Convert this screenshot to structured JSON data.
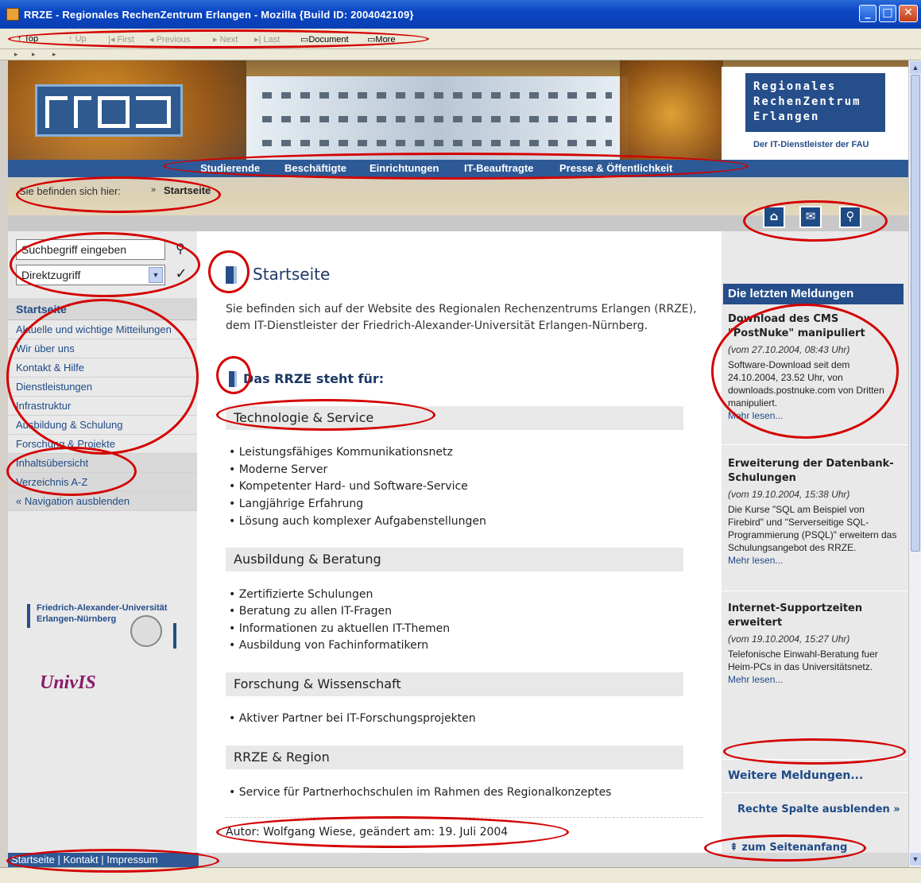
{
  "window": {
    "title": "RRZE - Regionales RechenZentrum Erlangen - Mozilla {Build ID: 2004042109}",
    "minimize": "_",
    "maximize": "□",
    "close": "✕"
  },
  "linkbar": {
    "top": "Top",
    "up": "Up",
    "first": "First",
    "previous": "Previous",
    "next": "Next",
    "last": "Last",
    "document": "Document",
    "more": "More"
  },
  "header": {
    "brand_lines": [
      "Regionales",
      "RechenZentrum",
      "Erlangen"
    ],
    "tagline": "Der IT-Dienstleister der FAU",
    "nav": [
      "Studierende",
      "Beschäftigte",
      "Einrichtungen",
      "IT-Beauftragte",
      "Presse & Öffentlichkeit"
    ],
    "breadcrumb_label": "Sie befinden sich hier:",
    "breadcrumb_current": "Startseite",
    "icons": [
      "home-icon",
      "mail-icon",
      "search-icon"
    ]
  },
  "left": {
    "search_value": "Suchbegriff eingeben",
    "direct_value": "Direktzugriff",
    "nav_head": "Startseite",
    "nav_items": [
      "Aktuelle und wichtige Mitteilungen",
      "Wir über uns",
      "Kontakt & Hilfe",
      "Dienstleistungen",
      "Infrastruktur",
      "Ausbildung & Schulung",
      "Forschung & Projekte",
      "Inhaltsübersicht",
      "Verzeichnis A-Z",
      "Navigation ausblenden"
    ],
    "fau_lines": [
      "Friedrich-Alexander-Universität",
      "Erlangen-Nürnberg"
    ],
    "univis": "UnivIS"
  },
  "footer": {
    "links": [
      "Startseite",
      "Kontakt",
      "Impressum"
    ],
    "separator": "|"
  },
  "main": {
    "title": "Startseite",
    "intro": "Sie befinden sich auf der Website des Regionalen Rechenzentrums Erlangen (RRZE), dem IT-Dienstleister der Friedrich-Alexander-Universität Erlangen-Nürnberg.",
    "subtitle": "Das RRZE steht für:",
    "sections": [
      {
        "heading": "Technologie & Service",
        "items": [
          "Leistungsfähiges Kommunikationsnetz",
          "Moderne Server",
          "Kompetenter Hard- und Software-Service",
          "Langjährige Erfahrung",
          "Lösung auch komplexer Aufgabenstellungen"
        ]
      },
      {
        "heading": "Ausbildung & Beratung",
        "items": [
          "Zertifizierte Schulungen",
          "Beratung zu allen IT-Fragen",
          "Informationen zu aktuellen IT-Themen",
          "Ausbildung von Fachinformatikern"
        ]
      },
      {
        "heading": "Forschung & Wissenschaft",
        "items": [
          "Aktiver Partner bei IT-Forschungsprojekten"
        ]
      },
      {
        "heading": "RRZE & Region",
        "items": [
          "Service für Partnerhochschulen im Rahmen des Regionalkonzeptes"
        ]
      }
    ],
    "author": "Autor: Wolfgang Wiese, geändert am: 19. Juli 2004"
  },
  "right": {
    "head": "Die letzten Meldungen",
    "news": [
      {
        "title": "Download des CMS \"PostNuke\" manipuliert",
        "date": "(vom 27.10.2004, 08:43 Uhr)",
        "body": "Software-Download seit dem 24.10.2004, 23.52 Uhr, von downloads.postnuke.com von Dritten manipuliert.",
        "more": "Mehr lesen..."
      },
      {
        "title": "Erweiterung der Datenbank-Schulungen",
        "date": "(vom 19.10.2004, 15:38 Uhr)",
        "body": "Die Kurse \"SQL am Beispiel von Firebird\" und \"Serverseitige SQL-Programmierung (PSQL)\" erweitern das Schulungsangebot des RRZE.",
        "more": "Mehr lesen..."
      },
      {
        "title": "Internet-Supportzeiten erweitert",
        "date": "(vom 19.10.2004, 15:27 Uhr)",
        "body": "Telefonische Einwahl-Beratung fuer Heim-PCs in das Universitätsnetz.",
        "more": "Mehr lesen..."
      }
    ],
    "more_news": "Weitere Meldungen...",
    "hide_column": "Rechte Spalte ausblenden »",
    "to_top": "zum Seitenanfang"
  }
}
